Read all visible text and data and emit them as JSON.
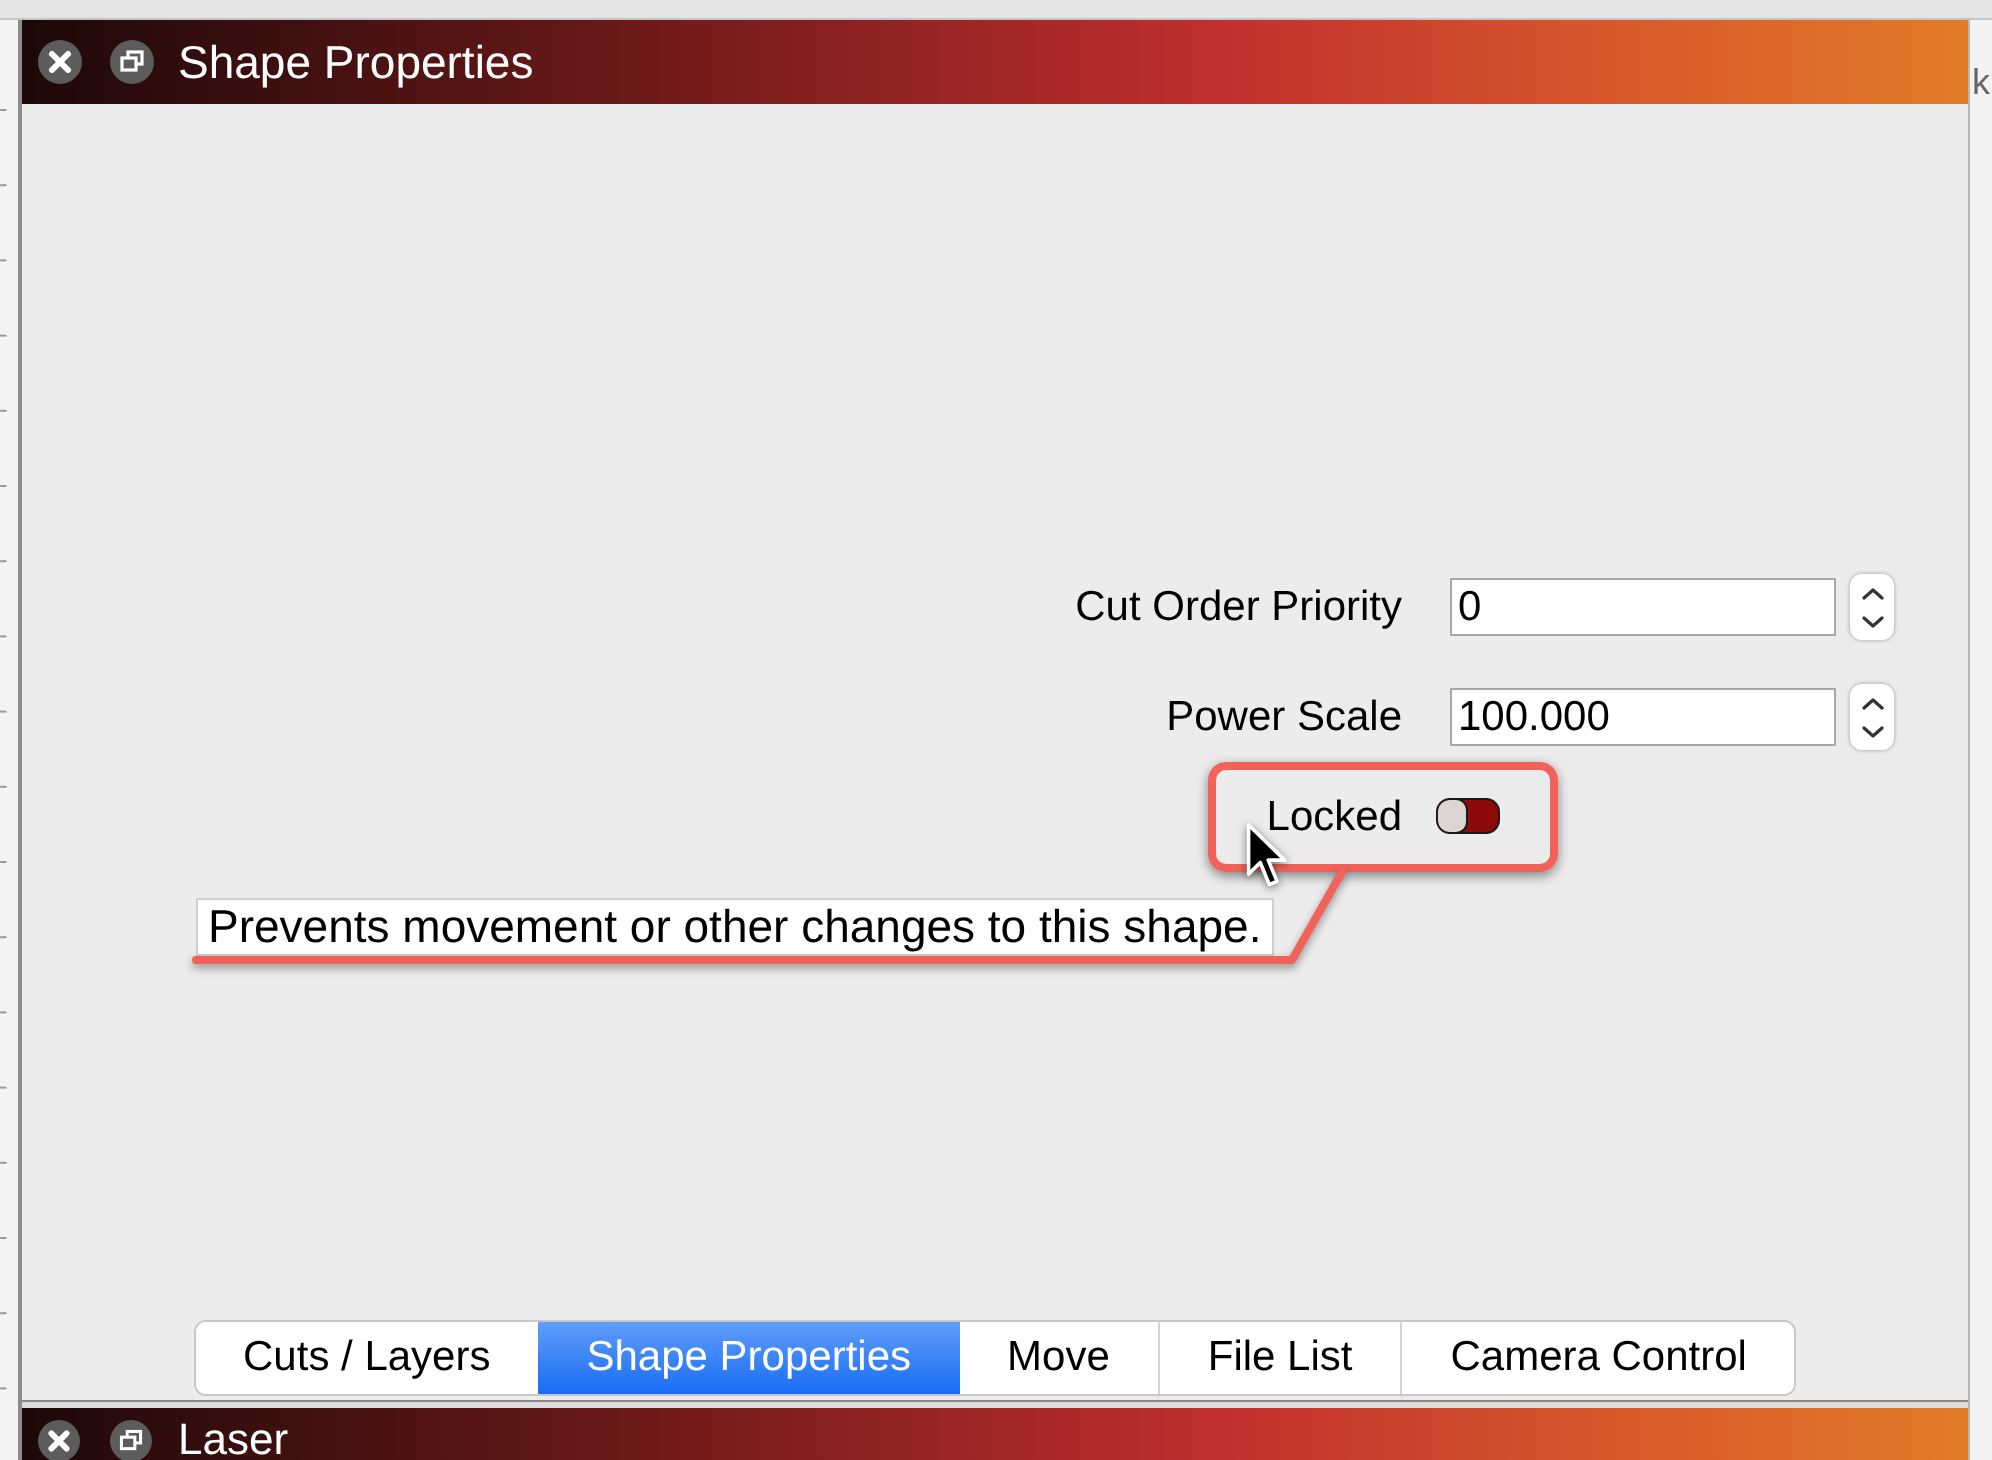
{
  "window": {
    "title": "Shape Properties"
  },
  "side_panel": {
    "text": "k"
  },
  "fields": [
    {
      "label": "Cut Order Priority",
      "value": "0"
    },
    {
      "label": "Power Scale",
      "value": "100.000"
    }
  ],
  "locked": {
    "label": "Locked",
    "checked": false
  },
  "tooltip": {
    "text": "Prevents movement or other changes to this shape."
  },
  "tabs": [
    {
      "label": "Cuts / Layers",
      "selected": false
    },
    {
      "label": "Shape Properties",
      "selected": true
    },
    {
      "label": "Move",
      "selected": false
    },
    {
      "label": "File List",
      "selected": false
    },
    {
      "label": "Camera Control",
      "selected": false
    }
  ],
  "next_window": {
    "title": "Laser"
  }
}
